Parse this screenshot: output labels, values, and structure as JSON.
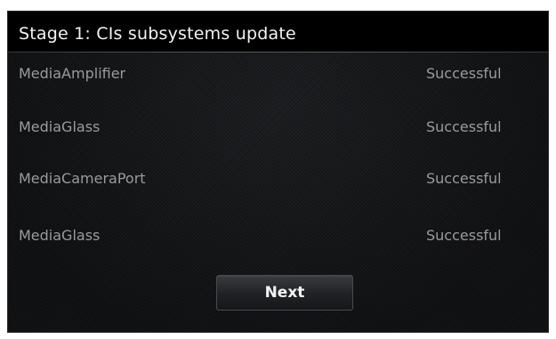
{
  "header": {
    "title": "Stage 1: CIs subsystems update"
  },
  "update_list": [
    {
      "name": "MediaAmplifier",
      "status": "Successful"
    },
    {
      "name": "MediaGlass",
      "status": "Successful"
    },
    {
      "name": "MediaCameraPort",
      "status": "Successful"
    },
    {
      "name": "MediaGlass",
      "status": "Successful"
    }
  ],
  "footer": {
    "next_label": "Next"
  },
  "colors": {
    "background": "#121315",
    "title_bar": "#000000",
    "title_text": "#f2f2f2",
    "row_text": "#9a9b9e",
    "button_border": "#4a4b4f"
  }
}
